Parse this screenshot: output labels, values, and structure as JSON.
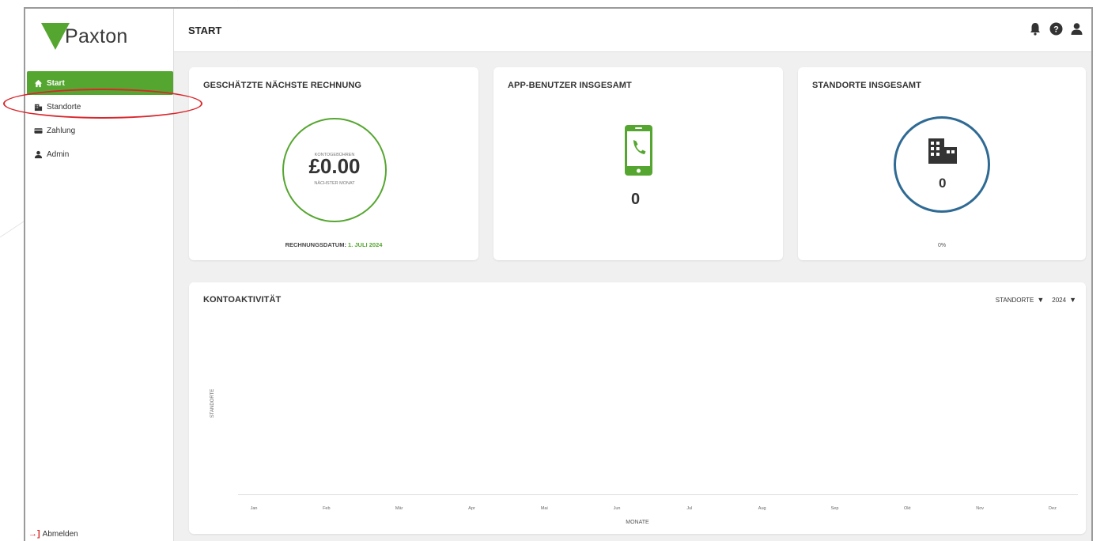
{
  "brand": {
    "name": "Paxton",
    "color": "#55a630"
  },
  "header": {
    "title": "START",
    "icons": [
      "bell-icon",
      "help-icon",
      "user-icon"
    ]
  },
  "sidebar": {
    "items": [
      {
        "label": "Start",
        "icon": "home-icon",
        "active": true
      },
      {
        "label": "Standorte",
        "icon": "building-icon",
        "active": false
      },
      {
        "label": "Zahlung",
        "icon": "card-icon",
        "active": false
      },
      {
        "label": "Admin",
        "icon": "user-icon",
        "active": false
      }
    ],
    "logout_label": "Abmelden"
  },
  "cards": {
    "invoice": {
      "title": "GESCHÄTZTE NÄCHSTE RECHNUNG",
      "fee_top_label": "KONTOGEBÜHREN",
      "amount": "£0.00",
      "fee_bottom_label": "NÄCHSTER MONAT",
      "date_label": "RECHNUNGSDATUM:",
      "date_value": "1. JULI 2024"
    },
    "app_users": {
      "title": "APP-BENUTZER INSGESAMT",
      "value": "0"
    },
    "sites": {
      "title": "STANDORTE INSGESAMT",
      "value": "0",
      "percent": "0%"
    }
  },
  "activity": {
    "title": "KONTOAKTIVITÄT",
    "filter_type": "STANDORTE",
    "filter_year": "2024",
    "y_label": "STANDORTE",
    "x_label": "MONATE",
    "months": [
      "Jan",
      "Feb",
      "Mär",
      "Apr",
      "Mai",
      "Jun",
      "Jul",
      "Aug",
      "Sep",
      "Okt",
      "Nov",
      "Dez"
    ]
  },
  "colors": {
    "accent": "#55a630",
    "sites_ring": "#2f6a94",
    "highlight": "#d9262c"
  }
}
